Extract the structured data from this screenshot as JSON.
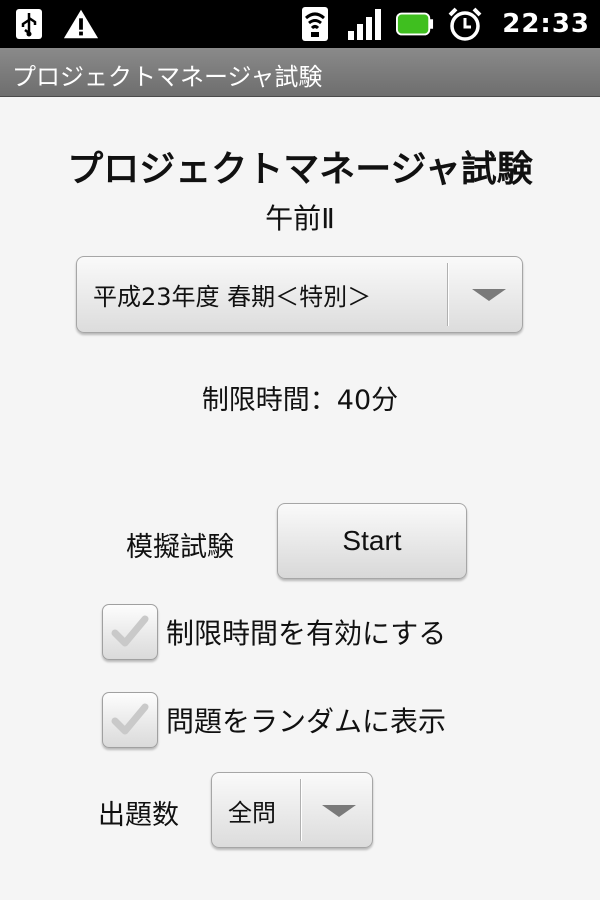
{
  "status_bar": {
    "time": "22:33",
    "left_icons": [
      "usb-icon",
      "warning-icon"
    ],
    "right_icons": [
      "wifi-icon",
      "signal-icon",
      "battery-icon",
      "alarm-clock-icon"
    ],
    "battery_color": "#3fbf1f"
  },
  "app_bar": {
    "title": "プロジェクトマネージャ試験"
  },
  "header": {
    "title": "プロジェクトマネージャ試験",
    "subtitle": "午前Ⅱ"
  },
  "exam_select": {
    "value": "平成23年度 春期＜特別＞"
  },
  "time_limit": {
    "text": "制限時間：40分"
  },
  "mock_exam": {
    "label": "模擬試験",
    "start_label": "Start"
  },
  "options": {
    "time_limit_enabled": {
      "label": "制限時間を有効にする",
      "checked": true
    },
    "random_order": {
      "label": "問題をランダムに表示",
      "checked": true
    }
  },
  "question_count": {
    "label": "出題数",
    "value": "全問"
  }
}
